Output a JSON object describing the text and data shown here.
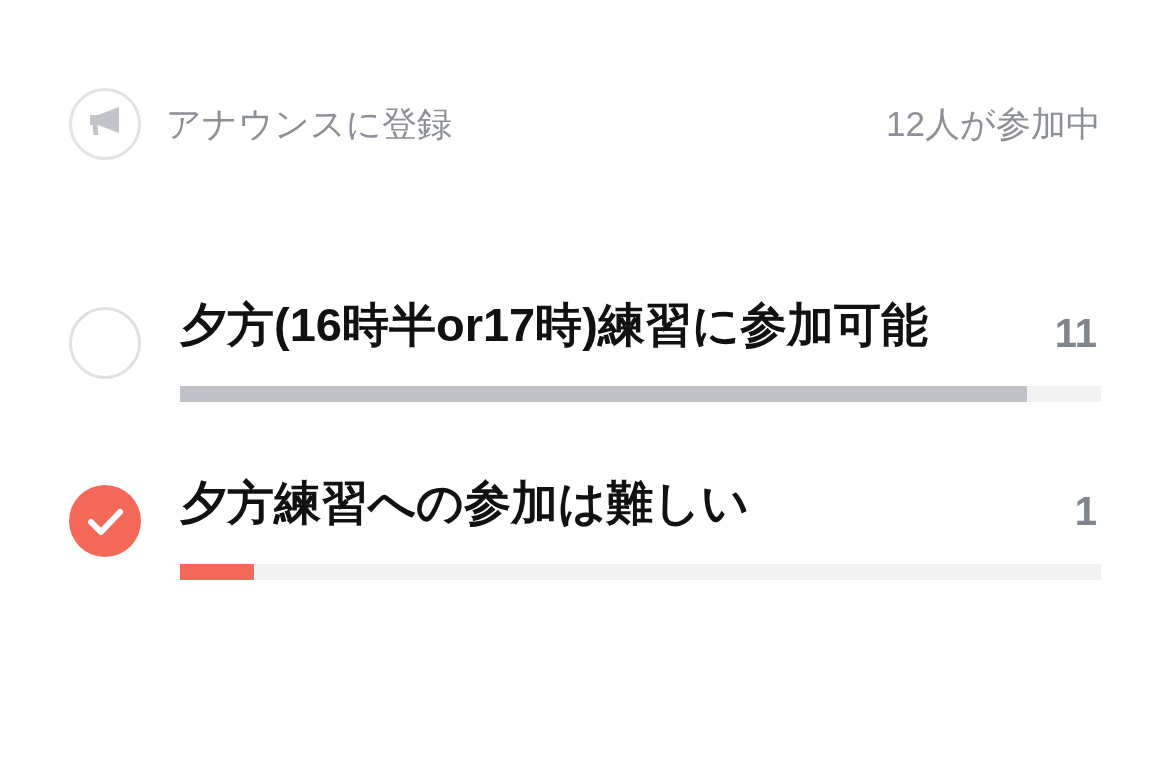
{
  "announcement": {
    "label": "アナウンスに登録",
    "participants": "12人が参加中"
  },
  "options": [
    {
      "label": "夕方(16時半or17時)練習に参加可能",
      "count": "11",
      "selected": false,
      "level": 0.92
    },
    {
      "label": "夕方練習への参加は難しい",
      "count": "1",
      "selected": true,
      "level": 0.08
    }
  ]
}
